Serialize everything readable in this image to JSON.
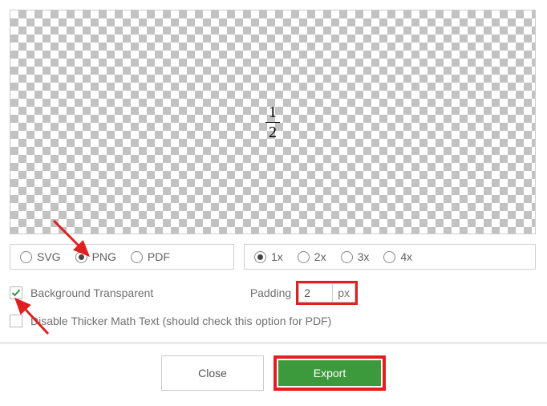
{
  "preview": {
    "numerator": "1",
    "denominator": "2"
  },
  "format": {
    "options": [
      "SVG",
      "PNG",
      "PDF"
    ],
    "selected": "PNG"
  },
  "scale": {
    "options": [
      "1x",
      "2x",
      "3x",
      "4x"
    ],
    "selected": "1x"
  },
  "bg_transparent": {
    "label": "Background Transparent",
    "checked": true
  },
  "padding": {
    "label": "Padding",
    "value": "2",
    "unit": "px"
  },
  "disable_thicker": {
    "label": "Disable Thicker Math Text (should check this option for PDF)",
    "checked": false
  },
  "buttons": {
    "close": "Close",
    "export": "Export"
  }
}
